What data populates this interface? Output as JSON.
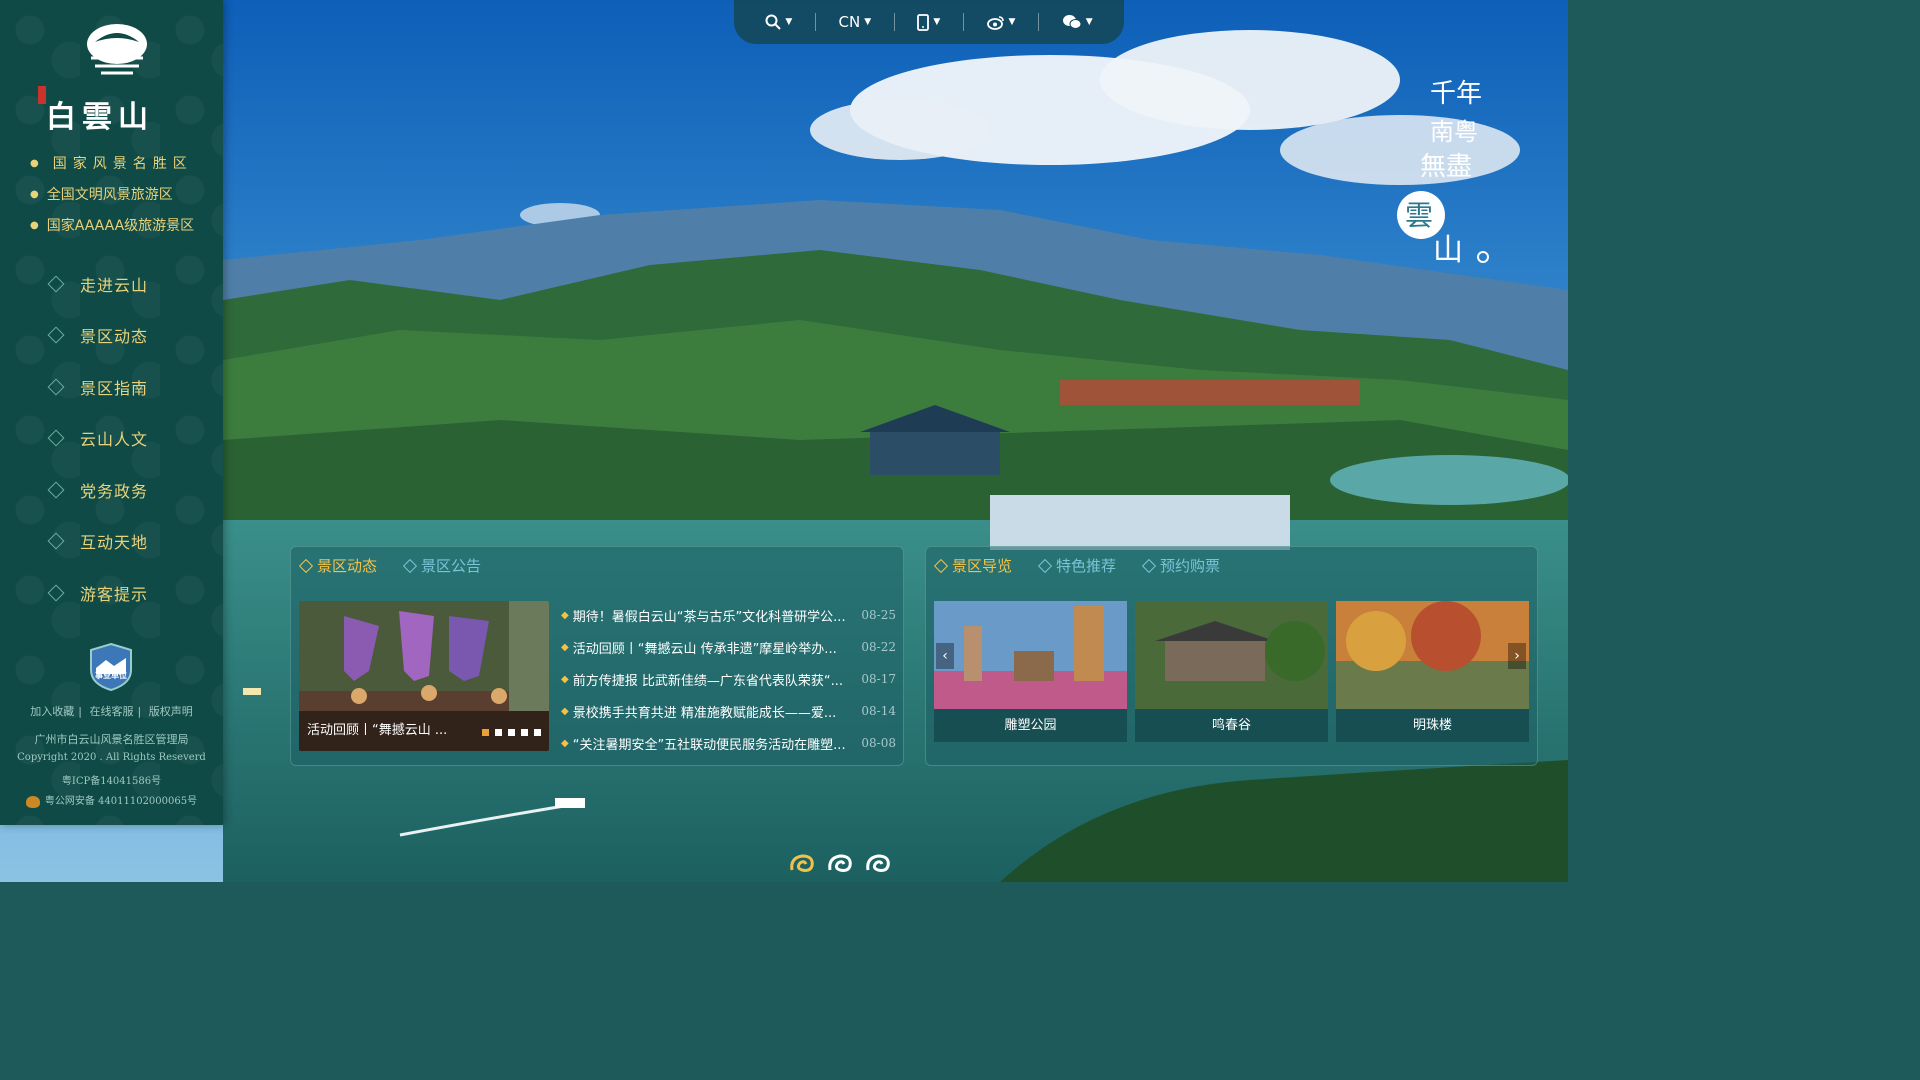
{
  "topbar": {
    "lang": "CN",
    "icons": [
      "search-icon",
      "mobile-icon",
      "weibo-icon",
      "wechat-icon"
    ]
  },
  "logo": {
    "text": "白雲山"
  },
  "slogans": [
    "国家风景名胜区",
    "全国文明风景旅游区",
    "国家AAAAA级旅游景区"
  ],
  "nav": [
    "走进云山",
    "景区动态",
    "景区指南",
    "云山人文",
    "党务政务",
    "互动天地",
    "游客提示"
  ],
  "footer": {
    "links": [
      "加入收藏",
      "在线客服",
      "版权声明"
    ],
    "org": "广州市白云山风景名胜区管理局",
    "copyright": "Copyright 2020 . All Rights Reseverd",
    "icp": "粤ICP备14041586号",
    "police": "粤公网安备 44011102000065号",
    "badge_text": "事业单位"
  },
  "calligraphy": {
    "line1": "千年",
    "line2": "南粤",
    "line3": "無盡",
    "line4": "雲",
    "line5": "山"
  },
  "news_panel": {
    "tabs": [
      "景区动态",
      "景区公告"
    ],
    "caption": "活动回顾丨“舞撼云山 ...",
    "items": [
      {
        "title": "期待！暑假白云山“茶与古乐”文化科普研学公...",
        "date": "08-25"
      },
      {
        "title": "活动回顾丨“舞撼云山 传承非遗”摩星岭举办...",
        "date": "08-22"
      },
      {
        "title": "前方传捷报 比武新佳绩—广东省代表队荣获“...",
        "date": "08-17"
      },
      {
        "title": "景校携手共育共进 精准施教赋能成长——爱...",
        "date": "08-14"
      },
      {
        "title": "“关注暑期安全”五社联动便民服务活动在雕塑...",
        "date": "08-08"
      }
    ]
  },
  "guide_panel": {
    "tabs": [
      "景区导览",
      "特色推荐",
      "预约购票"
    ],
    "cards": [
      {
        "label": "雕塑公园"
      },
      {
        "label": "鸣春谷"
      },
      {
        "label": "明珠楼"
      }
    ]
  },
  "colors": {
    "accent": "#f1c24b",
    "sidebar": "#0f4a46",
    "link": "#79c4d6"
  }
}
